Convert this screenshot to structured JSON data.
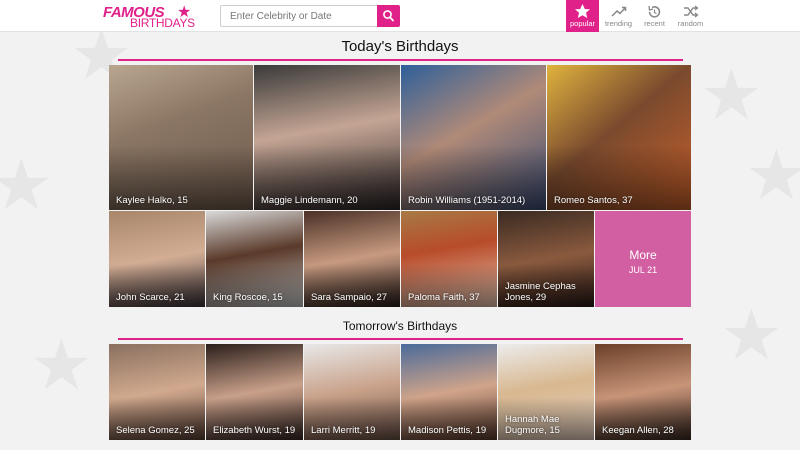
{
  "header": {
    "logo_top": "FAMOUS",
    "logo_bottom": "BIRTHDAYS",
    "search_placeholder": "Enter Celebrity or Date",
    "search_icon": "search-icon",
    "accent": "#e0218a",
    "nav": [
      {
        "label": "popular",
        "icon": "star-icon",
        "active": true
      },
      {
        "label": "trending",
        "icon": "trending-icon",
        "active": false
      },
      {
        "label": "recent",
        "icon": "recent-icon",
        "active": false
      },
      {
        "label": "random",
        "icon": "shuffle-icon",
        "active": false
      }
    ]
  },
  "today": {
    "title": "Today's Birthdays",
    "row1": [
      {
        "caption": "Kaylee Halko, 15"
      },
      {
        "caption": "Maggie Lindemann, 20"
      },
      {
        "caption": "Robin Williams (1951-2014)"
      },
      {
        "caption": "Romeo Santos, 37"
      }
    ],
    "row2": [
      {
        "caption": "John Scarce, 21"
      },
      {
        "caption": "King Roscoe, 15"
      },
      {
        "caption": "Sara Sampaio, 27"
      },
      {
        "caption": "Paloma Faith, 37"
      },
      {
        "caption": "Jasmine Cephas Jones, 29"
      }
    ],
    "more": {
      "label": "More",
      "date": "JUL 21"
    }
  },
  "tomorrow": {
    "title": "Tomorrow's Birthdays",
    "row": [
      {
        "caption": "Selena Gomez, 25"
      },
      {
        "caption": "Elizabeth Wurst, 19"
      },
      {
        "caption": "Larri Merritt, 19"
      },
      {
        "caption": "Madison Pettis, 19"
      },
      {
        "caption": "Hannah Mae Dugmore, 15"
      },
      {
        "caption": "Keegan Allen, 28"
      }
    ]
  }
}
